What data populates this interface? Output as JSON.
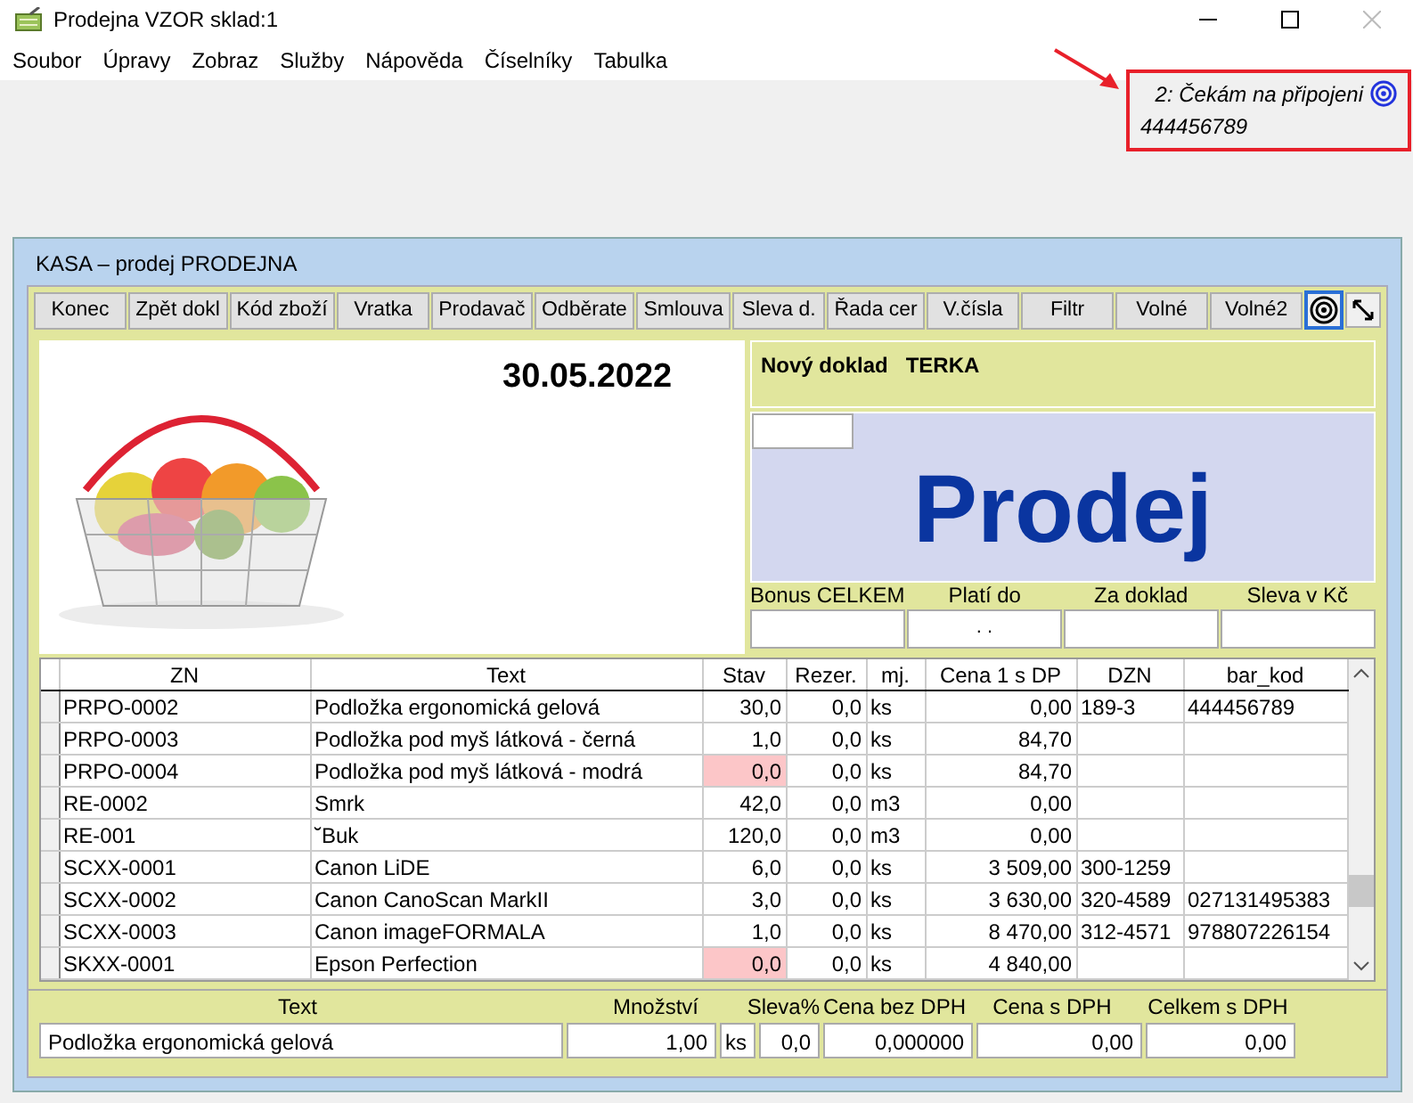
{
  "window": {
    "title": "Prodejna VZOR sklad:1"
  },
  "menu": [
    "Soubor",
    "Úpravy",
    "Zobraz",
    "Služby",
    "Nápověda",
    "Číselníky",
    "Tabulka"
  ],
  "status_note": {
    "line1": "2: Čekám na připojeni",
    "line2": "444456789"
  },
  "kasa": {
    "title": "KASA – prodej PRODEJNA",
    "toolbar": [
      {
        "label": "Konec"
      },
      {
        "label": "Zpět dokl"
      },
      {
        "label": "Kód zboží"
      },
      {
        "label": "Vratka"
      },
      {
        "label": "Prodavač"
      },
      {
        "label": "Odběrate"
      },
      {
        "label": "Smlouva"
      },
      {
        "label": "Sleva d."
      },
      {
        "label": "Řada cer"
      },
      {
        "label": "V.čísla"
      },
      {
        "label": "Filtr"
      },
      {
        "label": "Volné"
      },
      {
        "label": "Volné2"
      }
    ],
    "date": "30.05.2022",
    "document": {
      "label": "Nový doklad",
      "user": "TERKA"
    },
    "mode": "Prodej",
    "bonus_fields": [
      {
        "label": "Bonus CELKEM"
      },
      {
        "label": "Platí do",
        "value": ". ."
      },
      {
        "label": "Za doklad"
      },
      {
        "label": "Sleva v Kč"
      }
    ],
    "table": {
      "columns": [
        "ZN",
        "Text",
        "Stav",
        "Rezer.",
        "mj.",
        "Cena 1 s DP",
        "DZN",
        "bar_kod"
      ],
      "rows": [
        {
          "cells": [
            "PRPO-0002",
            "Podložka ergonomická gelová",
            "30,0",
            "0,0",
            "ks",
            "0,00",
            "189-3",
            "444456789"
          ],
          "alert": false
        },
        {
          "cells": [
            "PRPO-0003",
            "Podložka pod myš látková - černá",
            "1,0",
            "0,0",
            "ks",
            "84,70",
            "",
            ""
          ],
          "alert": false
        },
        {
          "cells": [
            "PRPO-0004",
            "Podložka pod myš látková - modrá",
            "0,0",
            "0,0",
            "ks",
            "84,70",
            "",
            ""
          ],
          "alert": true
        },
        {
          "cells": [
            "RE-0002",
            "Smrk",
            "42,0",
            "0,0",
            "m3",
            "0,00",
            "",
            ""
          ],
          "alert": false
        },
        {
          "cells": [
            "RE-001",
            "˘Buk",
            "120,0",
            "0,0",
            "m3",
            "0,00",
            "",
            ""
          ],
          "alert": false
        },
        {
          "cells": [
            "SCXX-0001",
            "Canon LiDE",
            "6,0",
            "0,0",
            "ks",
            "3 509,00",
            "300-1259",
            ""
          ],
          "alert": false
        },
        {
          "cells": [
            "SCXX-0002",
            "Canon CanoScan MarkII",
            "3,0",
            "0,0",
            "ks",
            "3 630,00",
            "320-4589",
            "027131495383"
          ],
          "alert": false
        },
        {
          "cells": [
            "SCXX-0003",
            "Canon imageFORMALA",
            "1,0",
            "0,0",
            "ks",
            "8 470,00",
            "312-4571",
            "978807226154"
          ],
          "alert": false
        },
        {
          "cells": [
            "SKXX-0001",
            "Epson Perfection",
            "0,0",
            "0,0",
            "ks",
            "4 840,00",
            "",
            ""
          ],
          "alert": true
        }
      ]
    },
    "entry": {
      "labels": [
        "Text",
        "Množství",
        "Sleva%",
        "Cena bez DPH",
        "Cena s DPH",
        "Celkem s DPH"
      ],
      "text": "Podložka ergonomická gelová",
      "qty": "1,00",
      "unit": "ks",
      "discount": "0,0",
      "price_net": "0,000000",
      "price": "0,00",
      "total": "0,00"
    }
  }
}
